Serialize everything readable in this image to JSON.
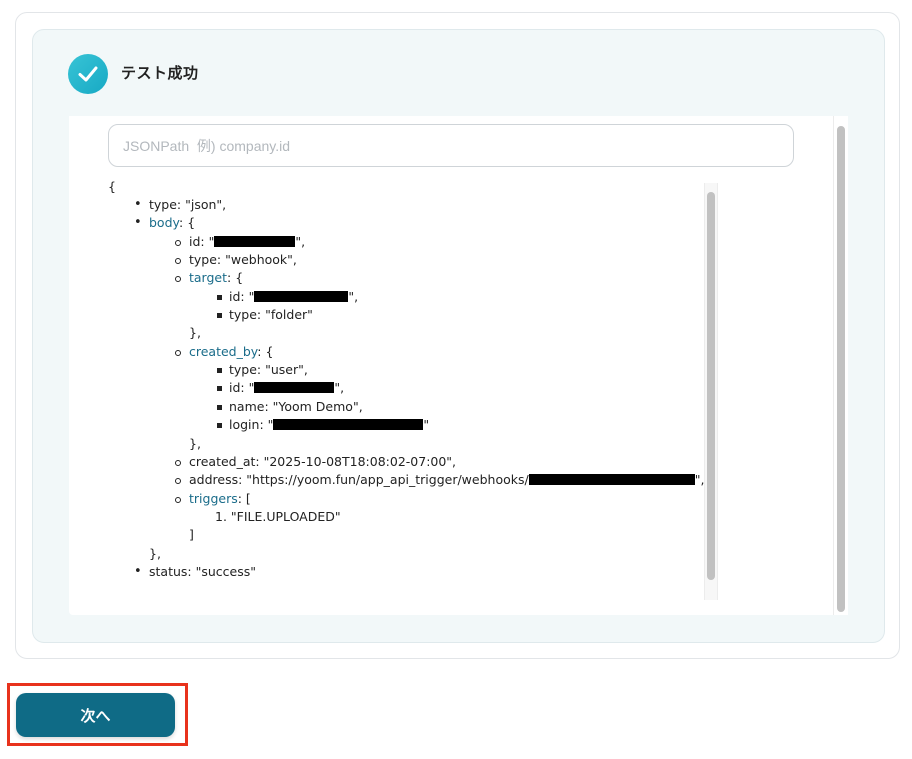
{
  "result": {
    "title": "テスト成功",
    "icon": "check-circle-icon",
    "accent_color": "#1fb3cb"
  },
  "jsonpath": {
    "placeholder": "JSONPath  例) company.id",
    "value": ""
  },
  "json_tree": {
    "open_brace": "{",
    "type_line": "type: \"json\",",
    "body_key": "body",
    "body_open": ": {",
    "body_id_prefix": "id: \"",
    "body_id_suffix": "\",",
    "body_type_line": "type: \"webhook\",",
    "target_key": "target",
    "target_open": ": {",
    "target_id_prefix": "id: \"",
    "target_id_suffix": "\",",
    "target_type_line": "type: \"folder\"",
    "target_close": "},",
    "created_by_key": "created_by",
    "created_by_open": ": {",
    "created_by_type_line": "type: \"user\",",
    "created_by_id_prefix": "id: \"",
    "created_by_id_suffix": "\",",
    "created_by_name_line": "name: \"Yoom Demo\",",
    "created_by_login_prefix": "login: \"",
    "created_by_login_suffix": "\"",
    "created_by_close": "},",
    "created_at_line": "created_at: \"2025-10-08T18:08:02-07:00\",",
    "address_prefix": "address: \"https://yoom.fun/app_api_trigger/webhooks/",
    "address_suffix": "\",",
    "triggers_key": "triggers",
    "triggers_open": ": [",
    "trigger_item": "1. \"FILE.UPLOADED\"",
    "triggers_close": "]",
    "body_close": "},",
    "status_line": "status: \"success\""
  },
  "actions": {
    "next_label": "次へ",
    "highlight_color": "#e8321c",
    "button_color": "#0f6b86"
  }
}
